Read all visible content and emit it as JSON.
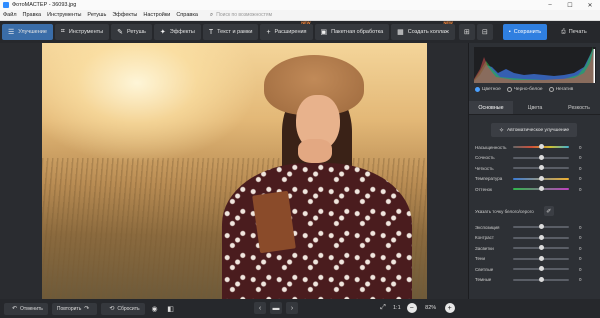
{
  "window": {
    "title": "ФотоМАСТЕР - 36093.jpg",
    "controls": [
      "–",
      "☐",
      "✕"
    ]
  },
  "menu": {
    "items": [
      "Файл",
      "Правка",
      "Инструменты",
      "Ретушь",
      "Эффекты",
      "Настройки",
      "Справка"
    ],
    "search_placeholder": "Поиск по возможностям"
  },
  "toolbar": {
    "tabs": [
      {
        "label": "Улучшение",
        "icon": "sliders-icon",
        "glyph": "☰",
        "active": true
      },
      {
        "label": "Инструменты",
        "icon": "crop-icon",
        "glyph": "⌗",
        "active": false
      },
      {
        "label": "Ретушь",
        "icon": "brush-icon",
        "glyph": "✎",
        "active": false
      },
      {
        "label": "Эффекты",
        "icon": "sparkle-icon",
        "glyph": "✦",
        "active": false
      },
      {
        "label": "Текст и рамки",
        "icon": "text-icon",
        "glyph": "T",
        "active": false
      },
      {
        "label": "Расширения",
        "icon": "plus-icon",
        "glyph": "+",
        "badge": "NEW",
        "active": false
      },
      {
        "label": "Пакетная обработка",
        "icon": "batch-icon",
        "glyph": "▣",
        "active": false
      },
      {
        "label": "Создать коллаж",
        "icon": "collage-icon",
        "glyph": "▦",
        "badge": "NEW",
        "active": false
      }
    ],
    "save_label": "Сохранить",
    "print_label": "Печать"
  },
  "panel": {
    "color_modes": [
      {
        "label": "Цветное",
        "on": true
      },
      {
        "label": "Черно-белое",
        "on": false
      },
      {
        "label": "Негатив",
        "on": false
      }
    ],
    "tabs": [
      {
        "label": "Основные",
        "active": true
      },
      {
        "label": "Цвета",
        "active": false
      },
      {
        "label": "Резкость",
        "active": false
      }
    ],
    "auto_label": "Автоматическое улучшение",
    "sliders_top": [
      {
        "label": "Насыщенность",
        "value": "0",
        "pos": 0.5,
        "style": "sat"
      },
      {
        "label": "Сочность",
        "value": "0",
        "pos": 0.5,
        "style": ""
      },
      {
        "label": "Четкость",
        "value": "0",
        "pos": 0.5,
        "style": ""
      },
      {
        "label": "Температура",
        "value": "0",
        "pos": 0.5,
        "style": "temp"
      },
      {
        "label": "Оттенок",
        "value": "0",
        "pos": 0.5,
        "style": "tint"
      }
    ],
    "wb_label": "Указать точку белого/серого",
    "sliders_bottom": [
      {
        "label": "Экспозиция",
        "value": "0",
        "pos": 0.5,
        "style": ""
      },
      {
        "label": "Контраст",
        "value": "0",
        "pos": 0.5,
        "style": ""
      },
      {
        "label": "Засветки",
        "value": "0",
        "pos": 0.5,
        "style": ""
      },
      {
        "label": "Тени",
        "value": "0",
        "pos": 0.5,
        "style": ""
      },
      {
        "label": "Светлые",
        "value": "0",
        "pos": 0.5,
        "style": ""
      },
      {
        "label": "Темные",
        "value": "0",
        "pos": 0.5,
        "style": ""
      }
    ]
  },
  "bottom": {
    "undo_label": "Отменить",
    "redo_label": "Повторить",
    "reset_label": "Сбросить",
    "ratio_label": "1:1",
    "zoom_value": "82%"
  }
}
